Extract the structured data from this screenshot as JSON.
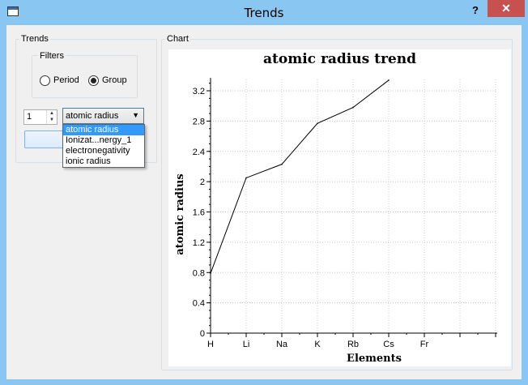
{
  "window": {
    "title": "Trends",
    "help_label": "?",
    "close_label": "✕"
  },
  "trends": {
    "group_label": "Trends",
    "filters_label": "Filters",
    "radio_period_label": "Period",
    "radio_group_label": "Group",
    "selected_filter": "Group",
    "spin_value": "1",
    "combo_value": "atomic radius",
    "dropdown_options": [
      "atomic radius",
      "Ionizat...nergy_1",
      "electronegativity",
      "ionic radius"
    ],
    "dropdown_selected_index": 0
  },
  "chart": {
    "group_label": "Chart",
    "chart_data": {
      "type": "line",
      "title": "atomic radius trend",
      "xlabel": "Elements",
      "ylabel": "atomic radius",
      "categories": [
        "H",
        "Li",
        "Na",
        "K",
        "Rb",
        "Cs",
        "Fr"
      ],
      "values": [
        0.79,
        2.05,
        2.23,
        2.77,
        2.98,
        3.34
      ],
      "yticks": [
        "0",
        "0.4",
        "0.8",
        "1.2",
        "1.6",
        "2",
        "2.4",
        "2.8",
        "3.2"
      ],
      "ylim": [
        0,
        3.35
      ],
      "grid": true
    }
  }
}
